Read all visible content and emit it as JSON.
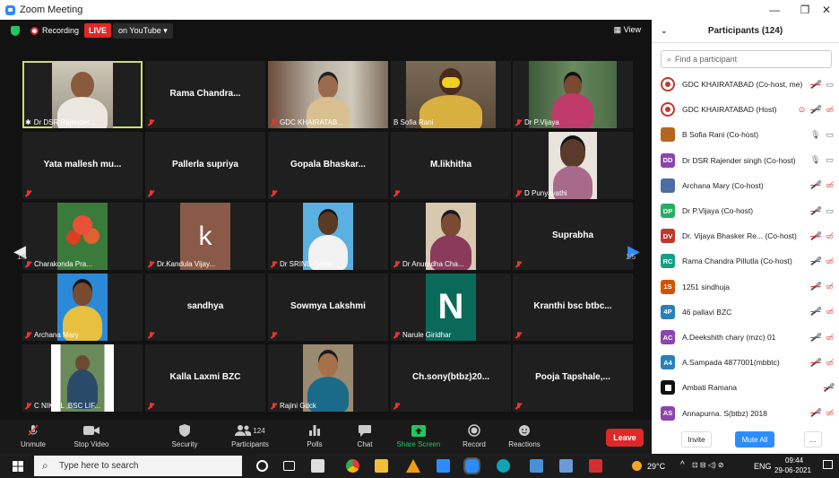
{
  "window": {
    "title": "Zoom Meeting",
    "minimize": "—",
    "restore": "❐",
    "close": "✕"
  },
  "topbar": {
    "recording": "Recording",
    "live": "LIVE",
    "stream": "on YouTube ▾",
    "view": "View"
  },
  "tiles": [
    {
      "text": "Dr DSR Rajender...",
      "type": "photo",
      "muted": false,
      "active": true
    },
    {
      "text": "Rama  Chandra...",
      "type": "name",
      "muted": true
    },
    {
      "text": "GDC KHAIRATAB...",
      "type": "photo",
      "muted": true
    },
    {
      "text": "B Sofia Rani",
      "type": "photo",
      "muted": false
    },
    {
      "text": "Dr P.Vijaya",
      "type": "photo",
      "muted": true
    },
    {
      "text": "Yata mallesh mu...",
      "type": "name",
      "muted": true
    },
    {
      "text": "Pallerla supriya",
      "type": "name",
      "muted": true
    },
    {
      "text": "Gopala  Bhaskar...",
      "type": "name",
      "muted": true
    },
    {
      "text": "M.likhitha",
      "type": "name",
      "muted": true
    },
    {
      "text": "D Punyavathi",
      "type": "photo",
      "muted": true
    },
    {
      "text": "Charakonda Pra...",
      "type": "photo",
      "muted": true
    },
    {
      "text": "Dr.Kandula Vijay...",
      "type": "photo",
      "muted": true
    },
    {
      "text": "Dr  SRINU Gante...",
      "type": "photo",
      "muted": true
    },
    {
      "text": "Dr Anuradha Cha...",
      "type": "photo",
      "muted": true
    },
    {
      "text": "Suprabha",
      "type": "name",
      "muted": true
    },
    {
      "text": "Archana Mary",
      "type": "photo",
      "muted": true
    },
    {
      "text": "sandhya",
      "type": "name",
      "muted": true
    },
    {
      "text": "Sowmya Lakshmi",
      "type": "name",
      "muted": true
    },
    {
      "text": "Narule Giridhar",
      "type": "photo",
      "muted": true
    },
    {
      "text": "Kranthi bsc btbc...",
      "type": "name",
      "muted": true
    },
    {
      "text": "C NIKHIL ,BSC LIF...",
      "type": "photo",
      "muted": true
    },
    {
      "text": "Kalla Laxmi  BZC",
      "type": "name",
      "muted": true
    },
    {
      "text": "Rajini Gdck",
      "type": "photo",
      "muted": true
    },
    {
      "text": "Ch.sony(btbz)20...",
      "type": "name",
      "muted": true
    },
    {
      "text": "Pooja  Tapshale,...",
      "type": "name",
      "muted": true
    }
  ],
  "tile_letters": {
    "kandula": "k",
    "narule": "N"
  },
  "pager": {
    "left": "1/5",
    "right": "1/5"
  },
  "controls": {
    "unmute": "Unmute",
    "stop_video": "Stop Video",
    "security": "Security",
    "participants": "Participants",
    "participants_count": "124",
    "polls": "Polls",
    "chat": "Chat",
    "share": "Share Screen",
    "record": "Record",
    "reactions": "Reactions",
    "leave": "Leave"
  },
  "panel": {
    "title": "Participants (124)",
    "search_placeholder": "Find a participant",
    "invite": "Invite",
    "mute_all": "Mute All",
    "more": "...",
    "participants": [
      {
        "name": "GDC KHAIRATABAD (Co-host, me)",
        "av": "",
        "color": "#c0392b",
        "logo": true,
        "mic": "muted",
        "video": "off"
      },
      {
        "name": "GDC KHAIRATABAD (Host)",
        "av": "",
        "color": "#c0392b",
        "logo": true,
        "mic": "muted",
        "video": "off-red",
        "share": true
      },
      {
        "name": "B Sofia Rani (Co-host)",
        "av": "",
        "color": "#b5651d",
        "photo": true,
        "mic": "on",
        "video": "off"
      },
      {
        "name": "Dr DSR Rajender singh (Co-host)",
        "av": "DD",
        "color": "#8e44ad",
        "mic": "on",
        "video": "off"
      },
      {
        "name": "Archana Mary (Co-host)",
        "av": "",
        "color": "#4a6fa5",
        "photo": true,
        "mic": "muted",
        "video": "off-red"
      },
      {
        "name": "Dr P.Vijaya (Co-host)",
        "av": "DP",
        "color": "#27ae60",
        "mic": "muted",
        "video": "off"
      },
      {
        "name": "Dr. Vijaya Bhasker Re...  (Co-host)",
        "av": "DV",
        "color": "#c0392b",
        "mic": "muted",
        "video": "off-red"
      },
      {
        "name": "Rama Chandra Pillutla (Co-host)",
        "av": "RC",
        "color": "#16a085",
        "mic": "muted",
        "video": "off-red"
      },
      {
        "name": "1251 sindhuja",
        "av": "1S",
        "color": "#d35400",
        "mic": "muted",
        "video": "off-red"
      },
      {
        "name": "46 pallavi BZC",
        "av": "4P",
        "color": "#2980b9",
        "mic": "muted",
        "video": "off-red"
      },
      {
        "name": "A.Deekshith chary (mzc) 01",
        "av": "AC",
        "color": "#8e44ad",
        "mic": "muted",
        "video": "off-red"
      },
      {
        "name": "A.Sampada 4877001(mbbtc)",
        "av": "A4",
        "color": "#2980b9",
        "mic": "muted",
        "video": "off-red"
      },
      {
        "name": "Ambati Ramana",
        "av": "",
        "color": "#111",
        "square": true,
        "mic": "muted",
        "video": ""
      },
      {
        "name": "Annapurna. S(btbz) 2018",
        "av": "AS",
        "color": "#8e44ad",
        "mic": "muted",
        "video": "off-red"
      }
    ]
  },
  "taskbar": {
    "search_placeholder": "Type here to search",
    "temp": "29°C",
    "lang": "ENG",
    "time": "09:44",
    "date": "29-06-2021"
  }
}
